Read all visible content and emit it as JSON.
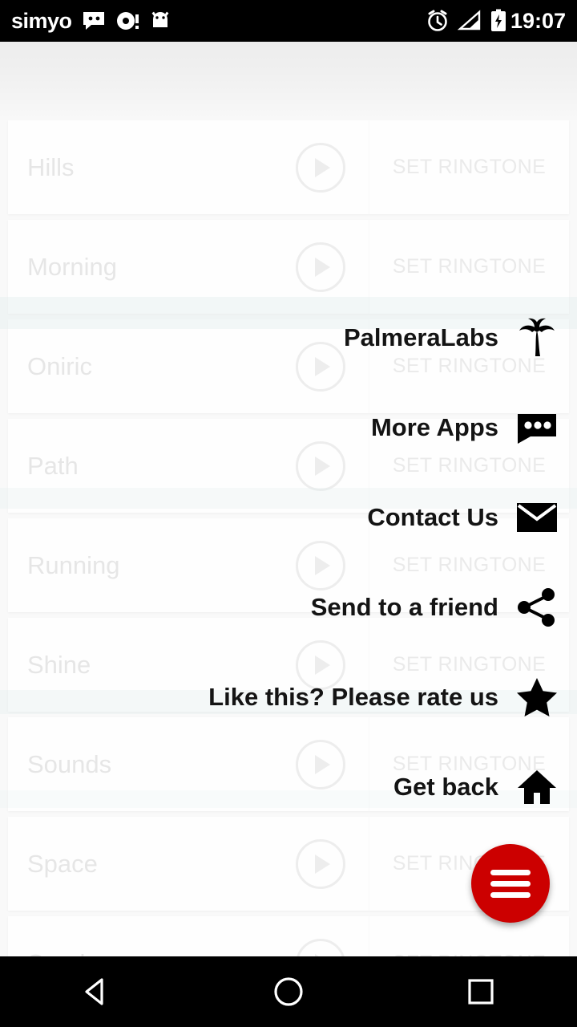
{
  "statusbar": {
    "carrier": "simyo",
    "clock": "19:07",
    "icons_left": [
      "chat-bubble-icon",
      "dot-circle-icon",
      "android-head-icon"
    ],
    "icons_right": [
      "alarm-icon",
      "signal-icon",
      "battery-charging-icon"
    ]
  },
  "list": {
    "set_label": "SET RINGTONE",
    "play_icon": "play-icon",
    "rows": [
      {
        "name": "Hills"
      },
      {
        "name": "Morning"
      },
      {
        "name": "Oniric"
      },
      {
        "name": "Path"
      },
      {
        "name": "Running"
      },
      {
        "name": "Shine"
      },
      {
        "name": "Sounds"
      },
      {
        "name": "Space"
      },
      {
        "name": "Sunrise"
      }
    ]
  },
  "fab_menu": {
    "open": true,
    "items": [
      {
        "label": "PalmeraLabs",
        "icon": "palm-tree-icon"
      },
      {
        "label": "More Apps",
        "icon": "more-bubble-icon"
      },
      {
        "label": "Contact Us",
        "icon": "envelope-icon"
      },
      {
        "label": "Send to a friend",
        "icon": "share-icon"
      },
      {
        "label": "Like this? Please rate us",
        "icon": "star-icon"
      },
      {
        "label": "Get back",
        "icon": "home-icon"
      }
    ],
    "fab_color": "#cc0000",
    "fab_icon": "menu-lines-icon"
  },
  "navbar": {
    "back": "back-triangle-icon",
    "home": "home-circle-icon",
    "recents": "recents-square-icon"
  }
}
